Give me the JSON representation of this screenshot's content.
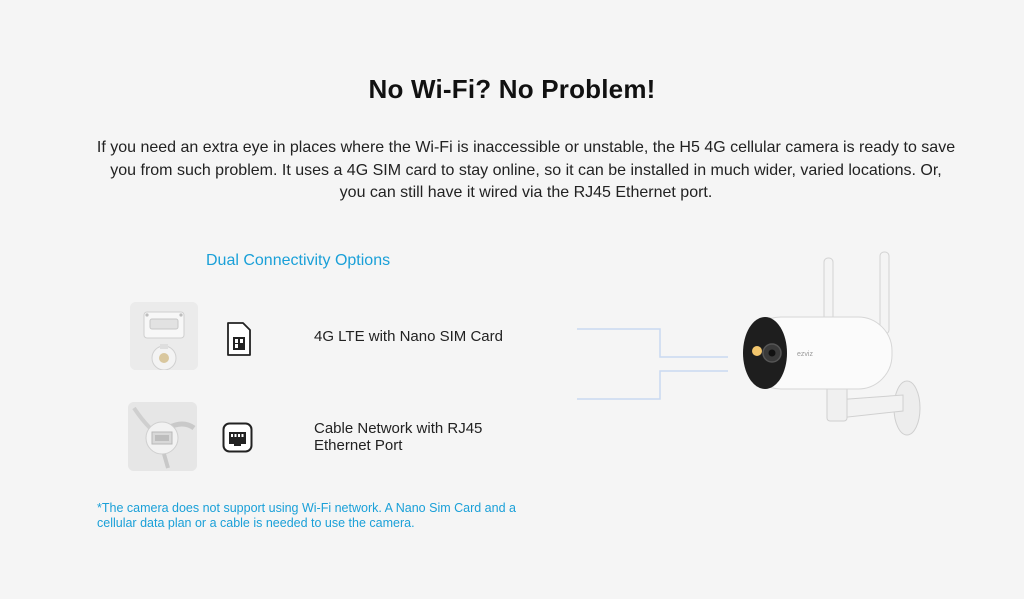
{
  "heading": "No Wi-Fi? No Problem!",
  "intro": "If you need an extra eye in places where the Wi-Fi is inaccessible or unstable, the H5 4G cellular camera is ready to save you from such problem. It uses a 4G SIM card to stay online, so it can be installed in much wider, varied locations. Or, you can still have it wired via the RJ45 Ethernet port.",
  "connectivity": {
    "heading": "Dual Connectivity Options",
    "options": [
      {
        "label": "4G LTE with Nano SIM Card",
        "icon": "sim-card-icon"
      },
      {
        "label": "Cable Network with RJ45 Ethernet Port",
        "icon": "ethernet-port-icon"
      }
    ]
  },
  "footnote": "*The camera does not support using Wi-Fi network. A Nano Sim Card and a cellular data plan or a cable is needed to use the camera.",
  "camera": {
    "brand_mark": "ezviz"
  },
  "colors": {
    "accent": "#1aa0d8",
    "connector": "#c9d9f2",
    "background": "#f5f5f5"
  }
}
